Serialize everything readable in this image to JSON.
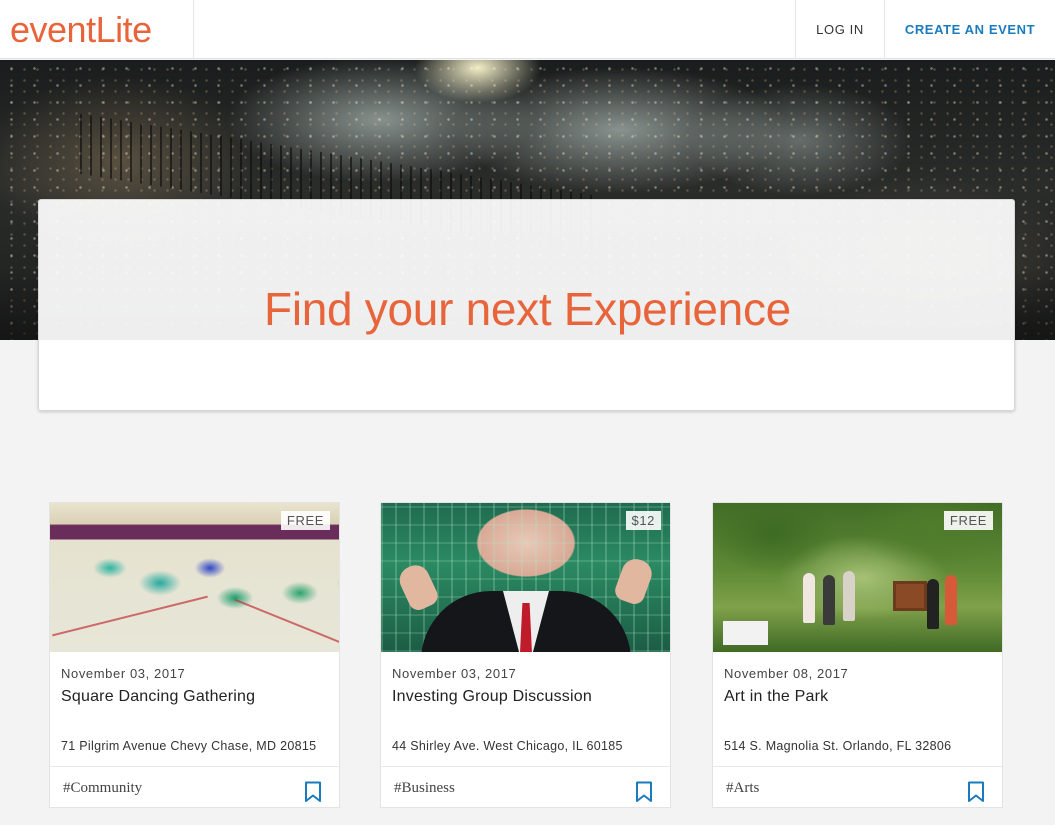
{
  "header": {
    "logo": "eventLite",
    "login_label": "LOG IN",
    "create_label": "CREATE AN EVENT"
  },
  "hero": {
    "headline": "Find your next Experience"
  },
  "colors": {
    "brand": "#e8643a",
    "link": "#1a7bbf"
  },
  "events": [
    {
      "price": "FREE",
      "date": "November 03, 2017",
      "title": "Square Dancing Gathering",
      "address": "71 Pilgrim Avenue Chevy Chase, MD 20815",
      "tag": "#Community",
      "icon": "bookmark-icon"
    },
    {
      "price": "$12",
      "date": "November 03, 2017",
      "title": "Investing Group Discussion",
      "address": "44 Shirley Ave. West Chicago, IL 60185",
      "tag": "#Business",
      "icon": "bookmark-icon"
    },
    {
      "price": "FREE",
      "date": "November 08, 2017",
      "title": "Art in the Park",
      "address": "514 S. Magnolia St. Orlando, FL 32806",
      "tag": "#Arts",
      "icon": "bookmark-icon"
    }
  ]
}
